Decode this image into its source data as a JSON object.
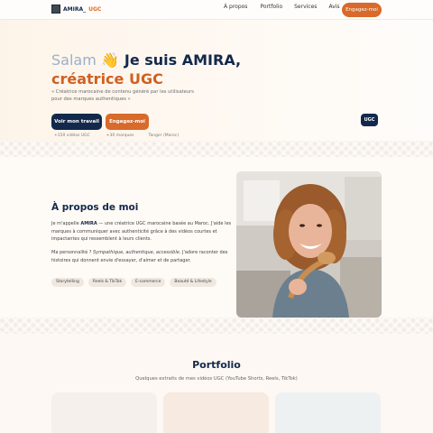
{
  "nav": {
    "logo_name": "AMIRA_",
    "logo_ugc": "UGC",
    "links": [
      "À propos",
      "Portfolio",
      "Services",
      "Avis"
    ],
    "cta": "Engagez-moi"
  },
  "hero": {
    "greeting": "Salam",
    "wave": "👋",
    "intro": " Je suis ",
    "name": "AMIRA,",
    "title_line2": "créatrice UGC",
    "subtitle": "« Créatrice marocaine de contenu généré par les utilisateurs pour des marques authentiques »",
    "btn_primary": "Voir mon travail",
    "btn_secondary": "Engagez-moi",
    "stats": [
      "+150 vidéos UGC",
      "+30 marques",
      "Tanger (Maroc)"
    ],
    "badge": "UGC"
  },
  "about": {
    "title": "À propos de moi",
    "p1_pre": "Je m'appelle ",
    "p1_name": "AMIRA",
    "p1_post": " — une créatrice UGC marocaine basée au Maroc. J'aide les marques à communiquer avec authenticité grâce à des vidéos courtes et impactantes qui ressemblent à leurs clients.",
    "p2_pre": "Ma personnalité ? ",
    "p2_italic": "Sympathique, authentique, accessible.",
    "p2_post": " J'adore raconter des histoires qui donnent envie d'essayer, d'aimer et de partager.",
    "tags": [
      "Storytelling",
      "Reels & TikTok",
      "E-commerce",
      "Beauté & Lifestyle"
    ]
  },
  "portfolio": {
    "title": "Portfolio",
    "subtitle": "Quelques extraits de mes vidéos UGC (YouTube Shorts, Reels, TikTok)"
  },
  "colors": {
    "navy": "#13294b",
    "orange": "#d86a2b",
    "cream": "#fdf8f3"
  }
}
